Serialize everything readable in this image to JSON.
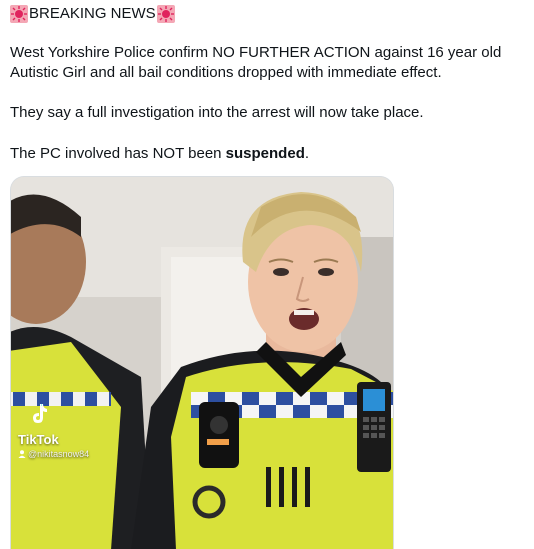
{
  "tweet": {
    "headline": "BREAKING NEWS",
    "headline_icon": "rotating-siren-icon",
    "paragraph1_line1": "West Yorkshire Police confirm NO FURTHER ACTION against 16 year old",
    "paragraph1_line2": "Autistic Girl and all bail conditions dropped with immediate effect.",
    "paragraph2": "They say a full investigation into the arrest will now take place.",
    "paragraph3_start": "The PC involved has NOT been ",
    "paragraph3_bold": "suspended",
    "paragraph3_end": "."
  },
  "media": {
    "watermark_brand": "TikTok",
    "watermark_handle": "@nikitasnow84",
    "watermark_icon": "tiktok-logo-icon"
  },
  "colors": {
    "text": "#0f1419",
    "siren_red": "#e0245e",
    "hi_vis_yellow": "#d8e13a"
  }
}
